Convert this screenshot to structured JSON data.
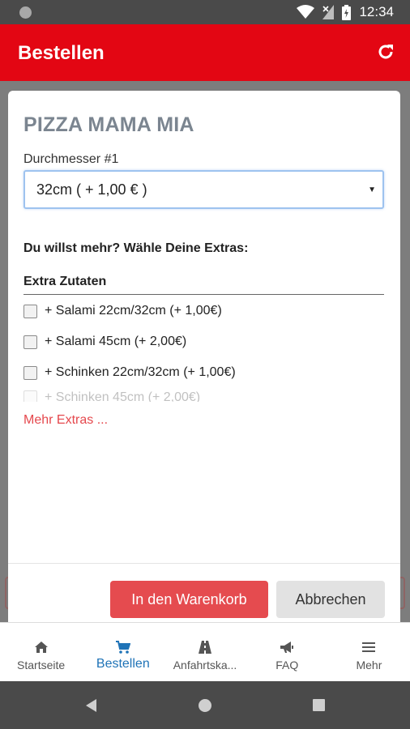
{
  "status_bar": {
    "time": "12:34",
    "icons": [
      "wifi-icon",
      "no-signal-icon",
      "battery-icon"
    ]
  },
  "app_bar": {
    "title": "Bestellen",
    "action_icon": "refresh-icon"
  },
  "modal": {
    "title": "PIZZA MAMA MIA",
    "diameter_label": "Durchmesser #1",
    "diameter_selected": "32cm ( + 1,00 € )",
    "extras_heading": "Du willst mehr? Wähle Deine Extras:",
    "group_heading": "Extra Zutaten",
    "extras": [
      {
        "label": "+ Salami 22cm/32cm (+ 1,00€)",
        "checked": false
      },
      {
        "label": "+ Salami 45cm (+ 2,00€)",
        "checked": false
      },
      {
        "label": "+ Schinken 22cm/32cm (+ 1,00€)",
        "checked": false
      },
      {
        "label": "+ Schinken 45cm (+ 2,00€)",
        "checked": false
      }
    ],
    "more_link": "Mehr Extras ...",
    "add_to_cart": "In den Warenkorb",
    "cancel": "Abbrechen"
  },
  "bottom_nav": [
    {
      "label": "Startseite",
      "icon": "home-icon",
      "active": false
    },
    {
      "label": "Bestellen",
      "icon": "cart-icon",
      "active": true
    },
    {
      "label": "Anfahrtska...",
      "icon": "road-icon",
      "active": false
    },
    {
      "label": "FAQ",
      "icon": "megaphone-icon",
      "active": false
    },
    {
      "label": "Mehr",
      "icon": "menu-icon",
      "active": false
    }
  ],
  "colors": {
    "brand": "#e30613",
    "accent_button": "#e54b4f",
    "active_nav": "#1f73b7",
    "link": "#e5484d"
  }
}
